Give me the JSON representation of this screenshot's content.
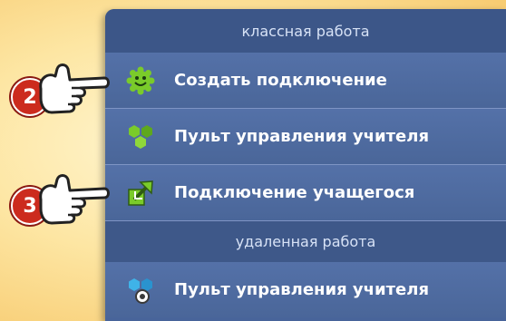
{
  "menu": {
    "sections": [
      {
        "header": "классная работа",
        "items": [
          {
            "label": "Создать подключение",
            "icon": "smiley-gear-icon"
          },
          {
            "label": "Пульт управления учителя",
            "icon": "green-hexagons-icon"
          },
          {
            "label": "Подключение учащегося",
            "icon": "connect-arrow-icon"
          }
        ]
      },
      {
        "header": "удаленная работа",
        "items": [
          {
            "label": "Пульт управления учителя",
            "icon": "blue-hexagons-icon"
          }
        ]
      }
    ]
  },
  "callouts": [
    {
      "number": "2",
      "target": "Создать подключение"
    },
    {
      "number": "3",
      "target": "Подключение учащегося"
    }
  ],
  "colors": {
    "menu_bg": "#48649a",
    "header_bg": "#3c5688",
    "badge": "#cc2b1e",
    "accent_green": "#7acb2a",
    "accent_blue": "#3fb3e8"
  }
}
